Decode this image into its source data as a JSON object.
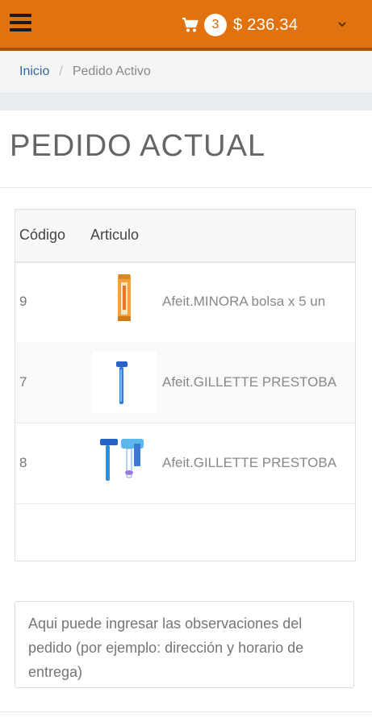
{
  "nav": {
    "cart_count": "3",
    "cart_total": "$ 236.34",
    "accent_color": "#e0730f"
  },
  "breadcrumb": {
    "home": "Inicio",
    "separator": "/",
    "current": "Pedido Activo"
  },
  "page": {
    "title": "PEDIDO ACTUAL"
  },
  "table": {
    "headers": [
      "Código",
      "Articulo"
    ],
    "rows": [
      {
        "code": "9",
        "name": "Afeit.MINORA bolsa x 5 un",
        "image": "orange-razor-pack"
      },
      {
        "code": "7",
        "name": "Afeit.GILLETTE PRESTOBA",
        "image": "blue-razor"
      },
      {
        "code": "8",
        "name": "Afeit.GILLETTE PRESTOBA",
        "image": "blue-razor-pack"
      }
    ]
  },
  "observations": {
    "placeholder": "Aqui puede ingresar las observaciones del pedido (por ejemplo: dirección y horario de entrega)"
  }
}
